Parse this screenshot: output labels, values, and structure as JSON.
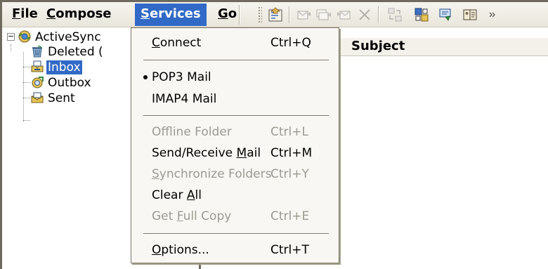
{
  "menubar": {
    "file": {
      "mnemonic": "F",
      "rest": "ile"
    },
    "compose": {
      "mnemonic": "C",
      "rest": "ompose"
    },
    "services": {
      "mnemonic": "S",
      "rest": "ervices"
    },
    "go": {
      "mnemonic": "G",
      "rest": "o"
    }
  },
  "toolbar": {
    "icons": [
      "properties-icon",
      "reply-icon",
      "reply-all-icon",
      "forward-icon",
      "delete-icon",
      "send-receive-icon",
      "folders-icon",
      "compose-icon",
      "address-book-icon"
    ]
  },
  "tree": {
    "root": {
      "label": "ActiveSync"
    },
    "children": [
      {
        "label": "Deleted ("
      },
      {
        "label": "Inbox",
        "selected": true
      },
      {
        "label": "Outbox"
      },
      {
        "label": "Sent"
      }
    ]
  },
  "columns": {
    "subject": "Subject"
  },
  "services_menu": {
    "connect": {
      "pre": "",
      "mn": "C",
      "post": "onnect",
      "accel": "Ctrl+Q"
    },
    "pop3": {
      "label": "POP3 Mail",
      "checked": true
    },
    "imap4": {
      "label": "IMAP4 Mail"
    },
    "offline": {
      "pre": "Offline Folder",
      "mn": "",
      "post": "",
      "accel": "Ctrl+L",
      "disabled": true
    },
    "sendreceive": {
      "pre": "Send/Receive ",
      "mn": "M",
      "post": "ail",
      "accel": "Ctrl+M"
    },
    "sync": {
      "pre": "",
      "mn": "S",
      "post": "ynchronize Folders",
      "accel": "Ctrl+Y",
      "disabled": true
    },
    "clearall": {
      "pre": "Clear ",
      "mn": "A",
      "post": "ll",
      "accel": ""
    },
    "fullcopy": {
      "pre": "Get ",
      "mn": "F",
      "post": "ull Copy",
      "accel": "Ctrl+E",
      "disabled": true
    },
    "options": {
      "pre": "",
      "mn": "O",
      "post": "ptions...",
      "accel": "Ctrl+T"
    }
  }
}
